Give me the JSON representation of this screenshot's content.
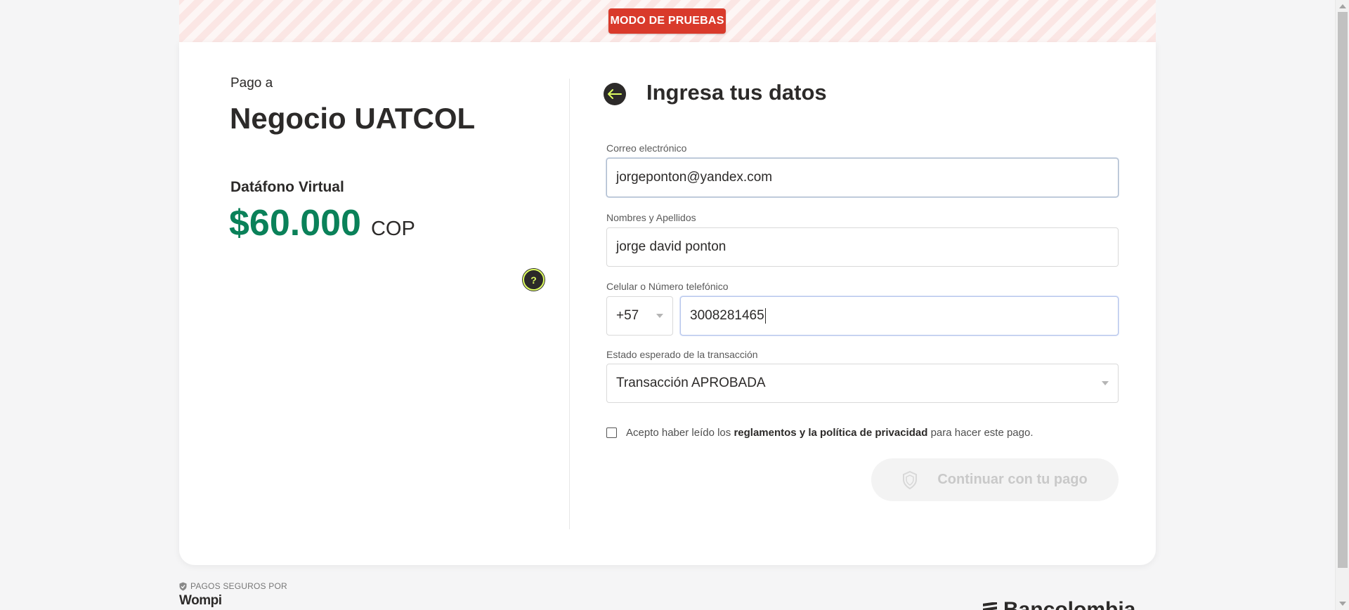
{
  "banner": {
    "test_mode_label": "MODO DE PRUEBAS"
  },
  "summary": {
    "pay_to_label": "Pago a",
    "merchant_name": "Negocio UATCOL",
    "product_name": "Datáfono Virtual",
    "amount": "$60.000",
    "currency": "COP",
    "help_icon": "question-icon",
    "help_label": "?"
  },
  "form": {
    "title": "Ingresa tus datos",
    "back_icon": "arrow-left-icon",
    "email": {
      "label": "Correo electrónico",
      "value": "jorgeponton@yandex.com"
    },
    "full_name": {
      "label": "Nombres y Apellidos",
      "value": "jorge david ponton"
    },
    "phone": {
      "label": "Celular o Número telefónico",
      "country_code": "+57",
      "value": "3008281465"
    },
    "expected_status": {
      "label": "Estado esperado de la transacción",
      "value": "Transacción APROBADA"
    },
    "terms": {
      "checked": false,
      "prefix": "Acepto haber leído los",
      "link": "reglamentos y la política de privacidad",
      "suffix": "para hacer este pago."
    },
    "continue_button": {
      "label": "Continuar con tu pago",
      "icon": "shield-icon",
      "enabled": false
    }
  },
  "footer": {
    "secure_label": "PAGOS SEGUROS POR",
    "provider": "Wompi",
    "partner": "Bancolombia"
  },
  "colors": {
    "accent_green": "#0a8159",
    "test_badge_red": "#d93a2b",
    "dark": "#2c2a29",
    "lime": "#dfff61"
  }
}
